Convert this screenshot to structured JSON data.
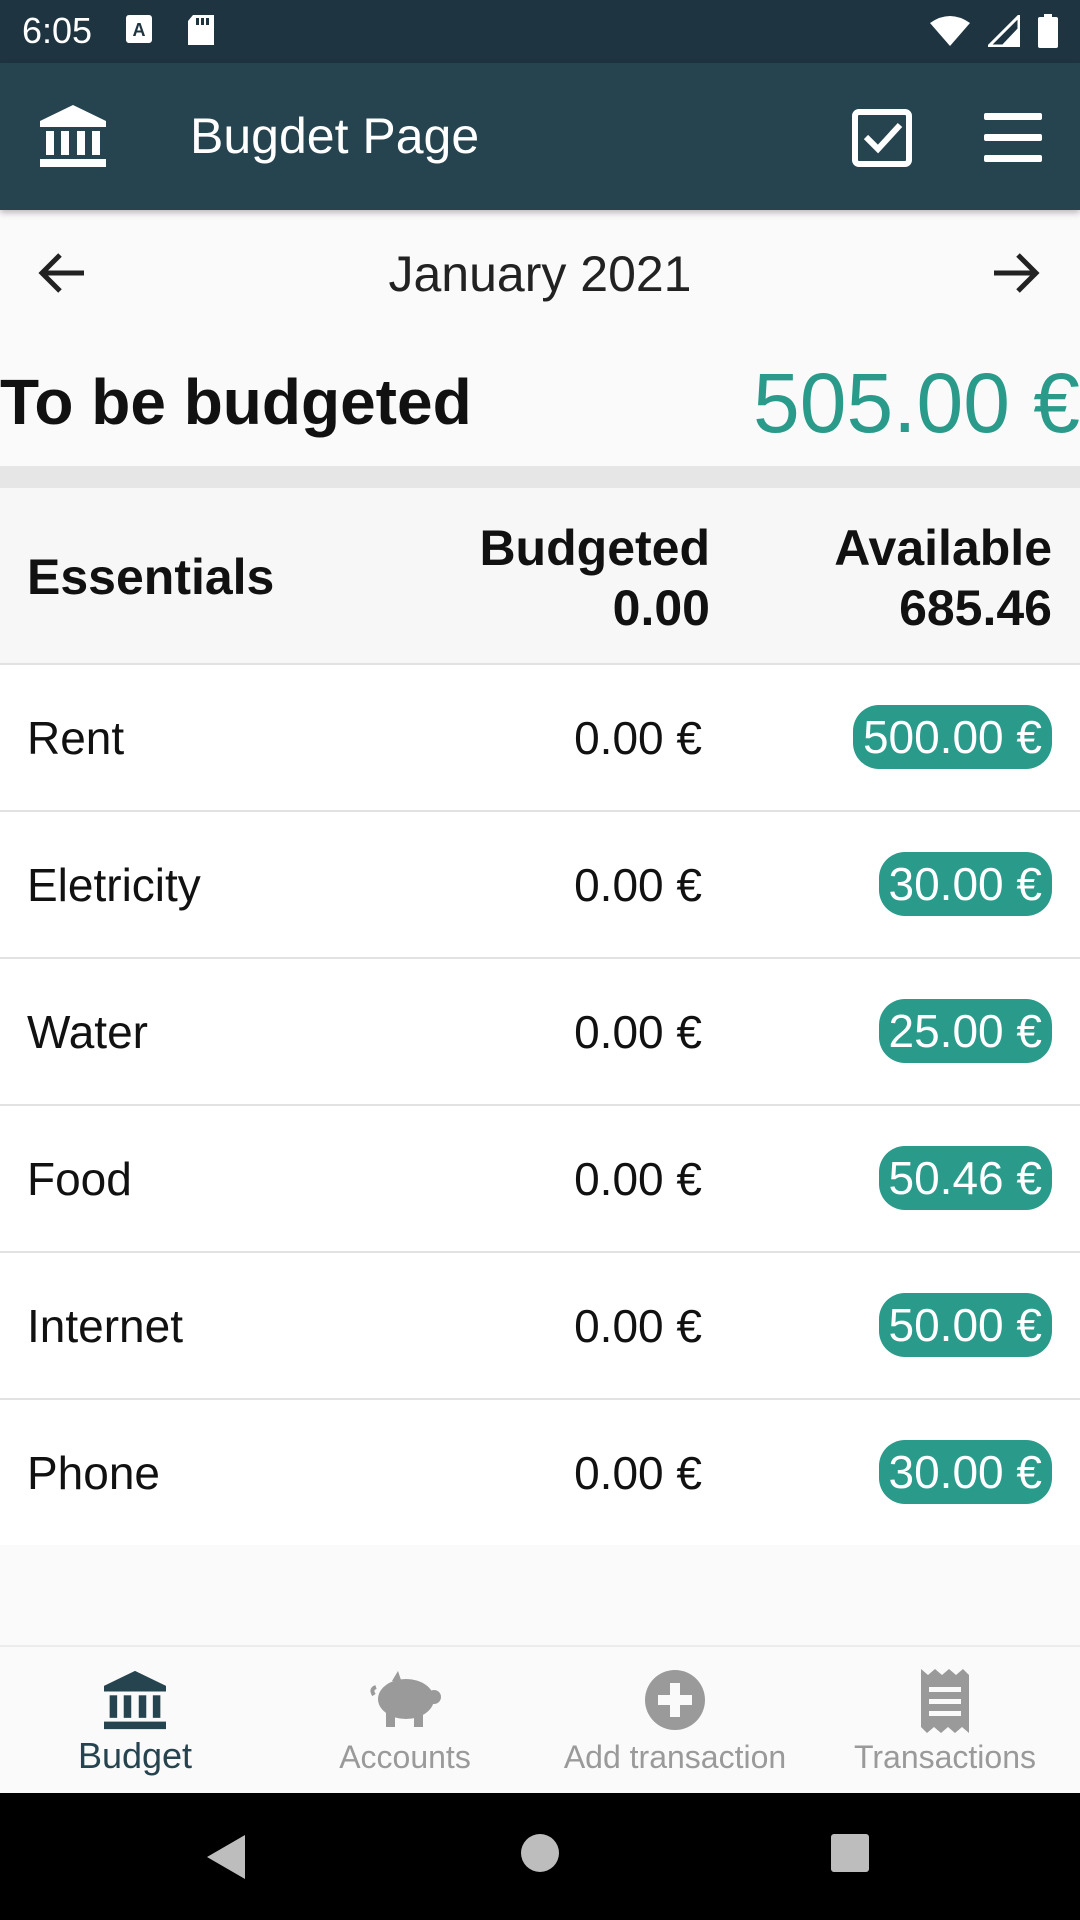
{
  "status_bar": {
    "time": "6:05",
    "icons": [
      "a-notification-icon",
      "sd-card-icon",
      "wifi-icon",
      "signal-icon",
      "battery-icon"
    ]
  },
  "app_bar": {
    "title": "Bugdet Page",
    "icons": [
      "bank-icon",
      "checkbox-icon",
      "hamburger-menu-icon"
    ],
    "color": "#26444f"
  },
  "month_nav": {
    "label": "January 2021"
  },
  "to_be_budgeted": {
    "label": "To be budgeted",
    "amount": "505.00 €",
    "color": "#2a9a8a"
  },
  "group": {
    "name": "Essentials",
    "budgeted_label": "Budgeted",
    "budgeted_value": "0.00",
    "available_label": "Available",
    "available_value": "685.46"
  },
  "categories": [
    {
      "name": "Rent",
      "budgeted": "0.00 €",
      "available": "500.00 €"
    },
    {
      "name": "Eletricity",
      "budgeted": "0.00 €",
      "available": "30.00 €"
    },
    {
      "name": "Water",
      "budgeted": "0.00 €",
      "available": "25.00 €"
    },
    {
      "name": "Food",
      "budgeted": "0.00 €",
      "available": "50.46 €"
    },
    {
      "name": "Internet",
      "budgeted": "0.00 €",
      "available": "50.00 €"
    },
    {
      "name": "Phone",
      "budgeted": "0.00 €",
      "available": "30.00 €"
    }
  ],
  "bottom_nav": {
    "tabs": [
      {
        "label": "Budget",
        "icon": "bank-icon",
        "active": true
      },
      {
        "label": "Accounts",
        "icon": "piggy-bank-icon",
        "active": false
      },
      {
        "label": "Add transaction",
        "icon": "plus-circle-icon",
        "active": false
      },
      {
        "label": "Transactions",
        "icon": "receipt-icon",
        "active": false
      }
    ]
  }
}
